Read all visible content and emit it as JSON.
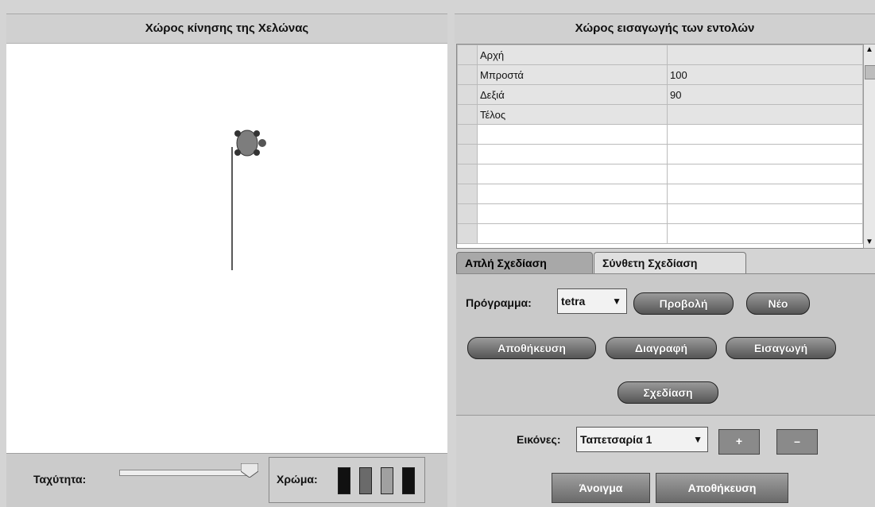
{
  "left_panel": {
    "title": "Χώρος κίνησης της Χελώνας",
    "speed_label": "Ταχύτητα:",
    "color_label": "Χρώμα:",
    "swatch_colors": [
      "#111111",
      "#6a6a6a",
      "#a0a0a0",
      "#111111"
    ]
  },
  "right_panel": {
    "title": "Χώρος εισαγωγής των εντολών",
    "commands": [
      {
        "command": "Αρχή",
        "value": ""
      },
      {
        "command": "Μπροστά",
        "value": "100"
      },
      {
        "command": "Δεξιά",
        "value": "90"
      },
      {
        "command": "Τέλος",
        "value": ""
      },
      {
        "command": "",
        "value": ""
      },
      {
        "command": "",
        "value": ""
      },
      {
        "command": "",
        "value": ""
      },
      {
        "command": "",
        "value": ""
      },
      {
        "command": "",
        "value": ""
      },
      {
        "command": "",
        "value": ""
      }
    ],
    "tabs": [
      "Απλή Σχεδίαση",
      "Σύνθετη Σχεδίαση"
    ],
    "program_label": "Πρόγραμμα:",
    "program_selected": "tetra",
    "buttons": {
      "view": "Προβολή",
      "new": "Νέο",
      "save": "Αποθήκευση",
      "delete": "Διαγραφή",
      "insert": "Εισαγωγή",
      "draw": "Σχεδίαση"
    },
    "images_label": "Εικόνες:",
    "images_selected": "Ταπετσαρία 1",
    "plus": "+",
    "minus": "–",
    "open": "Άνοιγμα",
    "save_image": "Αποθήκευση"
  }
}
